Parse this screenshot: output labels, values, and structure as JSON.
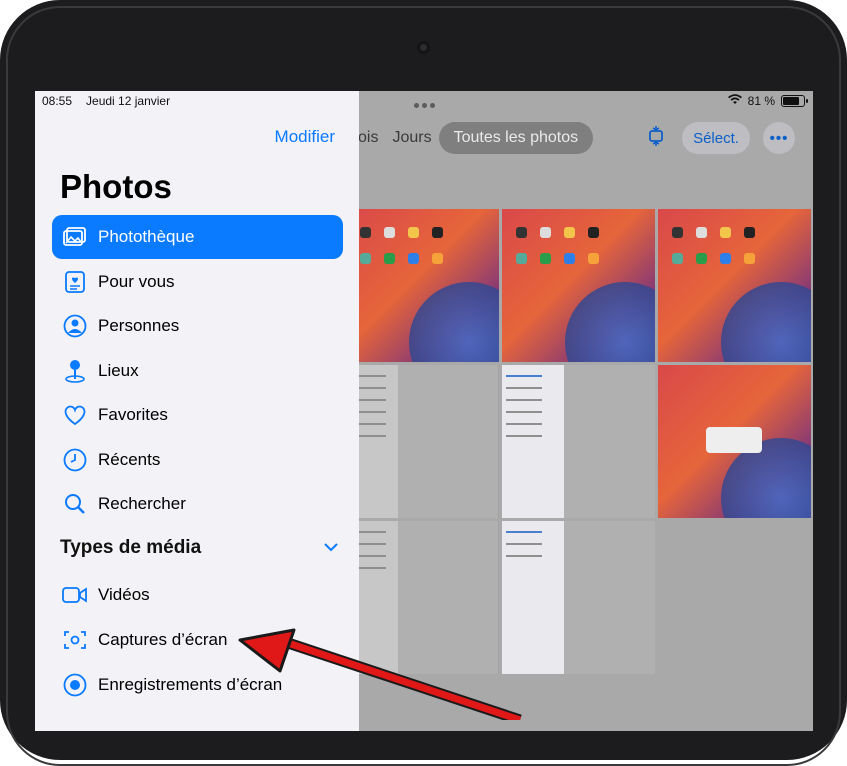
{
  "status_bar": {
    "time": "08:55",
    "date": "Jeudi 12 janvier",
    "battery": "81 %",
    "battery_level": 0.81
  },
  "sidebar": {
    "edit_label": "Modifier",
    "title": "Photos",
    "items": [
      {
        "label": "Photothèque",
        "icon": "photo-library-icon",
        "selected": true
      },
      {
        "label": "Pour vous",
        "icon": "for-you-icon"
      },
      {
        "label": "Personnes",
        "icon": "people-icon"
      },
      {
        "label": "Lieux",
        "icon": "places-pin-icon"
      },
      {
        "label": "Favorites",
        "icon": "heart-icon"
      },
      {
        "label": "Récents",
        "icon": "clock-icon"
      },
      {
        "label": "Rechercher",
        "icon": "search-icon"
      }
    ],
    "media_types_title": "Types de média",
    "media_items": [
      {
        "label": "Vidéos",
        "icon": "video-icon"
      },
      {
        "label": "Captures d’écran",
        "icon": "screenshot-icon"
      },
      {
        "label": "Enregistrements d’écran",
        "icon": "screen-recording-icon"
      }
    ]
  },
  "toolbar": {
    "segments": [
      "ois",
      "Jours",
      "Toutes les photos"
    ],
    "active_segment": "Toutes les photos",
    "select_label": "Sélect.",
    "more_icon": "ellipsis-icon",
    "aspect_icon": "aspect-ratio-icon"
  },
  "colors": {
    "accent": "#0a7aff",
    "sidebar_bg": "#f2f2f7",
    "annotation_arrow": "#e01818"
  }
}
